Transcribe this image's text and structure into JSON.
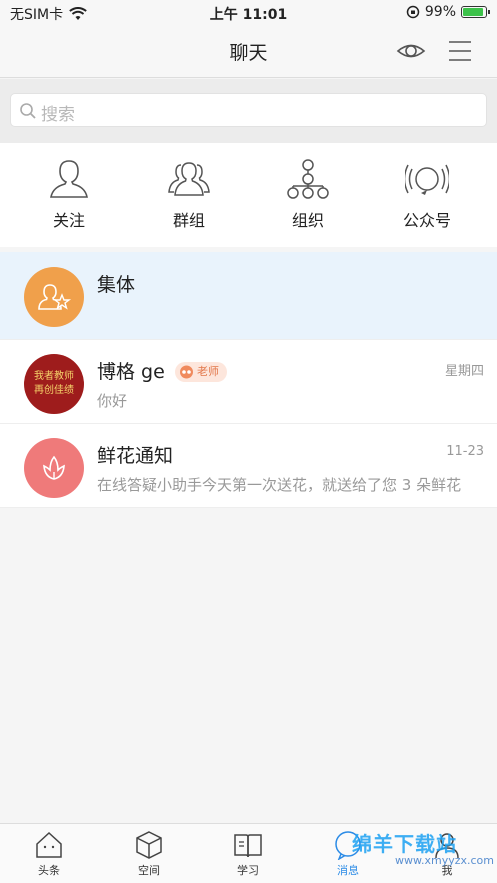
{
  "status": {
    "carrier": "无SIM卡",
    "time": "上午 11:01",
    "battery": "99%"
  },
  "nav": {
    "title": "聊天"
  },
  "search": {
    "placeholder": "搜索"
  },
  "quick": [
    {
      "label": "关注",
      "icon": "user-icon"
    },
    {
      "label": "群组",
      "icon": "group-icon"
    },
    {
      "label": "组织",
      "icon": "org-chart-icon"
    },
    {
      "label": "公众号",
      "icon": "broadcast-icon"
    }
  ],
  "conversations": [
    {
      "title": "集体",
      "time": "",
      "message": "",
      "avatar_color": "#f0a04b",
      "icon": "collective-icon"
    },
    {
      "title": "博格 ge",
      "badge": "老师",
      "time": "星期四",
      "message": "你好",
      "avatar_color": "#9e1c1c",
      "avatar_text": "我者教师 再创佳绩"
    },
    {
      "title": "鲜花通知",
      "time": "11-23",
      "message": "在线答疑小助手今天第一次送花，就送给了您 3 朵鲜花",
      "avatar_color": "#ef7a7a",
      "icon": "flower-icon"
    }
  ],
  "tabs": [
    {
      "label": "头条",
      "icon": "home-icon"
    },
    {
      "label": "空间",
      "icon": "cube-icon"
    },
    {
      "label": "学习",
      "icon": "book-icon"
    },
    {
      "label": "消息",
      "icon": "message-icon",
      "active": true
    },
    {
      "label": "我",
      "icon": "me-icon"
    }
  ],
  "watermark": {
    "text": "绵羊下载站",
    "url": "www.xmyyzx.com"
  }
}
